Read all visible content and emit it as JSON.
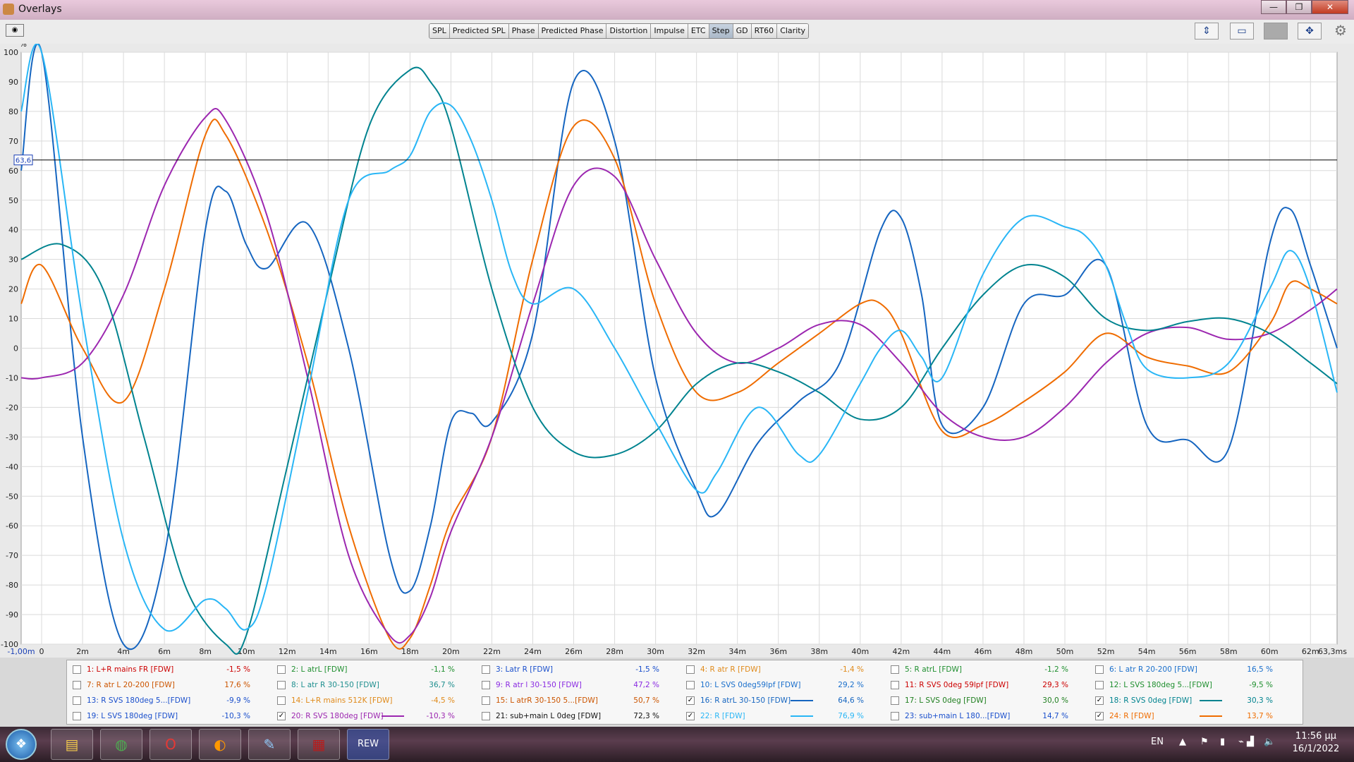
{
  "window": {
    "title": "Overlays",
    "minimize": "—",
    "maximize": "❐",
    "close": "✕"
  },
  "toolbar": {
    "tabs": [
      "SPL",
      "Predicted SPL",
      "Phase",
      "Predicted Phase",
      "Distortion",
      "Impulse",
      "ETC",
      "Step",
      "GD",
      "RT60",
      "Clarity"
    ],
    "active_tab": "Step",
    "camera_label": "◉"
  },
  "chart_data": {
    "type": "line",
    "ylabel": "%",
    "ylim": [
      -100,
      100
    ],
    "xlim": [
      -1,
      63.3
    ],
    "yticks": [
      "100",
      "90",
      "80",
      "70",
      "60",
      "50",
      "40",
      "30",
      "20",
      "10",
      "0",
      "-10",
      "-20",
      "-30",
      "-40",
      "-50",
      "-60",
      "-70",
      "-80",
      "-90",
      "-100"
    ],
    "xticks": [
      "-1,00m",
      "0",
      "2m",
      "4m",
      "6m",
      "8m",
      "10m",
      "12m",
      "14m",
      "16m",
      "18m",
      "20m",
      "22m",
      "24m",
      "26m",
      "28m",
      "30m",
      "32m",
      "34m",
      "36m",
      "38m",
      "40m",
      "42m",
      "44m",
      "46m",
      "48m",
      "50m",
      "52m",
      "54m",
      "56m",
      "58m",
      "60m",
      "62m",
      "63,3ms"
    ],
    "cursor_y": 63.6,
    "cursor_label": "63,6",
    "series": [
      {
        "color": "#1565c0",
        "x": [
          -1,
          0,
          2,
          4,
          6,
          8,
          9,
          10,
          11,
          13,
          15,
          17,
          18,
          19,
          20,
          21,
          22,
          24,
          26,
          28,
          30,
          32,
          33,
          35,
          37,
          39,
          41,
          42,
          43,
          44,
          46,
          48,
          50,
          52,
          54,
          56,
          58,
          60,
          61,
          62,
          63.3
        ],
        "y": [
          60,
          100,
          -30,
          -100,
          -70,
          40,
          53,
          35,
          27,
          42,
          0,
          -70,
          -82,
          -60,
          -25,
          -22,
          -25,
          5,
          90,
          70,
          -10,
          -48,
          -56,
          -32,
          -18,
          -5,
          40,
          44,
          18,
          -26,
          -20,
          15,
          18,
          28,
          -26,
          -31,
          -34,
          35,
          47,
          28,
          0
        ]
      },
      {
        "color": "#ef6c00",
        "x": [
          -1,
          0,
          2,
          4,
          6,
          8,
          9,
          11,
          13,
          15,
          17,
          18,
          19,
          20,
          22,
          24,
          26,
          28,
          30,
          32,
          34,
          36,
          38,
          40,
          41,
          42,
          44,
          46,
          48,
          50,
          52,
          54,
          56,
          58,
          60,
          61,
          62,
          63.3
        ],
        "y": [
          15,
          28,
          0,
          -18,
          20,
          72,
          72,
          40,
          -5,
          -60,
          -98,
          -98,
          -80,
          -58,
          -30,
          30,
          75,
          64,
          15,
          -15,
          -15,
          -5,
          5,
          15,
          15,
          5,
          -28,
          -26,
          -18,
          -8,
          5,
          -3,
          -6,
          -8,
          8,
          22,
          20,
          15
        ]
      },
      {
        "color": "#9c27b0",
        "x": [
          -1,
          0,
          2,
          4,
          6,
          8,
          9,
          11,
          13,
          15,
          17,
          18,
          19,
          20,
          22,
          24,
          26,
          28,
          30,
          32,
          34,
          36,
          38,
          40,
          42,
          44,
          46,
          48,
          50,
          52,
          54,
          56,
          58,
          60,
          62,
          63.3
        ],
        "y": [
          -10,
          -10,
          -5,
          18,
          55,
          78,
          77,
          45,
          -10,
          -70,
          -97,
          -97,
          -84,
          -62,
          -30,
          15,
          55,
          58,
          30,
          5,
          -5,
          0,
          8,
          8,
          -5,
          -22,
          -30,
          -30,
          -20,
          -5,
          5,
          7,
          3,
          5,
          13,
          20
        ]
      },
      {
        "color": "#00838f",
        "x": [
          -1,
          1,
          3,
          5,
          7,
          9,
          10,
          12,
          14,
          16,
          18,
          19,
          20,
          22,
          24,
          26,
          28,
          30,
          32,
          34,
          36,
          38,
          40,
          42,
          44,
          46,
          48,
          50,
          52,
          54,
          56,
          58,
          60,
          62,
          63.3
        ],
        "y": [
          30,
          35,
          20,
          -30,
          -80,
          -100,
          -97,
          -40,
          20,
          75,
          94,
          90,
          75,
          20,
          -20,
          -35,
          -36,
          -28,
          -12,
          -5,
          -8,
          -15,
          -24,
          -20,
          0,
          18,
          28,
          24,
          10,
          6,
          9,
          10,
          5,
          -5,
          -12
        ]
      },
      {
        "color": "#29b6f6",
        "x": [
          -1,
          0,
          2,
          4,
          6,
          8,
          9,
          10,
          11,
          13,
          15,
          17,
          18,
          19,
          20,
          21,
          22,
          23,
          24,
          26,
          28,
          30,
          32,
          33,
          35,
          37,
          38,
          40,
          41,
          42,
          43,
          44,
          46,
          48,
          50,
          51,
          52,
          53,
          54,
          56,
          58,
          60,
          61,
          62,
          63.3
        ],
        "y": [
          80,
          100,
          10,
          -65,
          -95,
          -85,
          -88,
          -95,
          -80,
          -15,
          50,
          60,
          65,
          80,
          82,
          70,
          50,
          25,
          15,
          20,
          0,
          -25,
          -48,
          -42,
          -20,
          -36,
          -36,
          -12,
          0,
          6,
          -3,
          -10,
          25,
          44,
          41,
          38,
          28,
          8,
          -7,
          -10,
          -5,
          20,
          33,
          20,
          -15
        ]
      }
    ]
  },
  "legend": [
    [
      {
        "num": "1:",
        "name": "L+R mains FR [FDW]",
        "val": "-1,5 %",
        "color": "#cc0000",
        "checked": false
      },
      {
        "num": "2:",
        "name": "L atrL [FDW]",
        "val": "-1,1 %",
        "color": "#1f8f2f",
        "checked": false
      },
      {
        "num": "3:",
        "name": "Latr R [FDW]",
        "val": "-1,5 %",
        "color": "#1a4fcc",
        "checked": false
      },
      {
        "num": "4:",
        "name": "R atr R [FDW]",
        "val": "-1,4 %",
        "color": "#e08a1a",
        "checked": false
      },
      {
        "num": "5:",
        "name": "R atrL [FDW]",
        "val": "-1,2 %",
        "color": "#1f8f2f",
        "checked": false
      },
      {
        "num": "6:",
        "name": "L atr R 20-200 [FDW]",
        "val": "16,5 %",
        "color": "#1a6fcc",
        "checked": false
      }
    ],
    [
      {
        "num": "7:",
        "name": "R atr L 20-200 [FDW]",
        "val": "17,6 %",
        "color": "#cc5500",
        "checked": false
      },
      {
        "num": "8:",
        "name": "L atr R 30-150 [FDW]",
        "val": "36,7 %",
        "color": "#1f8f8f",
        "checked": false
      },
      {
        "num": "9:",
        "name": "R atr l 30-150 [FDW]",
        "val": "47,2 %",
        "color": "#8a2be2",
        "checked": false
      },
      {
        "num": "10:",
        "name": "L SVS 0deg59lpf [FDW]",
        "val": "29,2 %",
        "color": "#1a6fcc",
        "checked": false
      },
      {
        "num": "11:",
        "name": "R SVS 0deg 59lpf [FDW]",
        "val": "29,3 %",
        "color": "#cc0000",
        "checked": false
      },
      {
        "num": "12:",
        "name": "L SVS 180deg 5...[FDW]",
        "val": "-9,5 %",
        "color": "#1f8f2f",
        "checked": false
      }
    ],
    [
      {
        "num": "13:",
        "name": "R SVS 180deg 5...[FDW]",
        "val": "-9,9 %",
        "color": "#1a4fcc",
        "checked": false
      },
      {
        "num": "14:",
        "name": "L+R mains 512K [FDW]",
        "val": "-4,5 %",
        "color": "#e08a1a",
        "checked": false
      },
      {
        "num": "15:",
        "name": "L atrR 30-150 5...[FDW]",
        "val": "50,7 %",
        "color": "#cc5500",
        "checked": false
      },
      {
        "num": "16:",
        "name": "R atrL 30-150 [FDW]",
        "val": "64,6 %",
        "color": "#1565c0",
        "checked": true
      },
      {
        "num": "17:",
        "name": "L SVS 0deg [FDW]",
        "val": "30,0 %",
        "color": "#1f7f1f",
        "checked": false
      },
      {
        "num": "18:",
        "name": "R SVS 0deg [FDW]",
        "val": "30,3 %",
        "color": "#00838f",
        "checked": true
      }
    ],
    [
      {
        "num": "19:",
        "name": "L SVS 180deg [FDW]",
        "val": "-10,3 %",
        "color": "#1a4fcc",
        "checked": false
      },
      {
        "num": "20:",
        "name": "R SVS 180deg [FDW]",
        "val": "-10,3 %",
        "color": "#9c27b0",
        "checked": true
      },
      {
        "num": "21:",
        "name": "sub+main  L 0deg [FDW]",
        "val": "72,3 %",
        "color": "#111111",
        "checked": false
      },
      {
        "num": "22:",
        "name": "R [FDW]",
        "val": "76,9 %",
        "color": "#29b6f6",
        "checked": true
      },
      {
        "num": "23:",
        "name": "sub+main L 180...[FDW]",
        "val": "14,7 %",
        "color": "#1a4fcc",
        "checked": false
      },
      {
        "num": "24:",
        "name": "R [FDW]",
        "val": "13,7 %",
        "color": "#ef6c00",
        "checked": true
      }
    ]
  ],
  "taskbar": {
    "start": "❖",
    "apps": [
      {
        "name": "explorer",
        "glyph": "▤",
        "color": "#f2c94c"
      },
      {
        "name": "chrome",
        "glyph": "◍",
        "color": "#4caf50"
      },
      {
        "name": "opera",
        "glyph": "O",
        "color": "#e53935"
      },
      {
        "name": "avast",
        "glyph": "◐",
        "color": "#ff9800"
      },
      {
        "name": "paint",
        "glyph": "✎",
        "color": "#90caf9"
      },
      {
        "name": "winrar",
        "glyph": "▦",
        "color": "#b71c1c"
      },
      {
        "name": "rew",
        "glyph": "REW",
        "color": "#1565c0"
      }
    ],
    "lang": "EN",
    "time": "11:56 μμ",
    "date": "16/1/2022"
  }
}
